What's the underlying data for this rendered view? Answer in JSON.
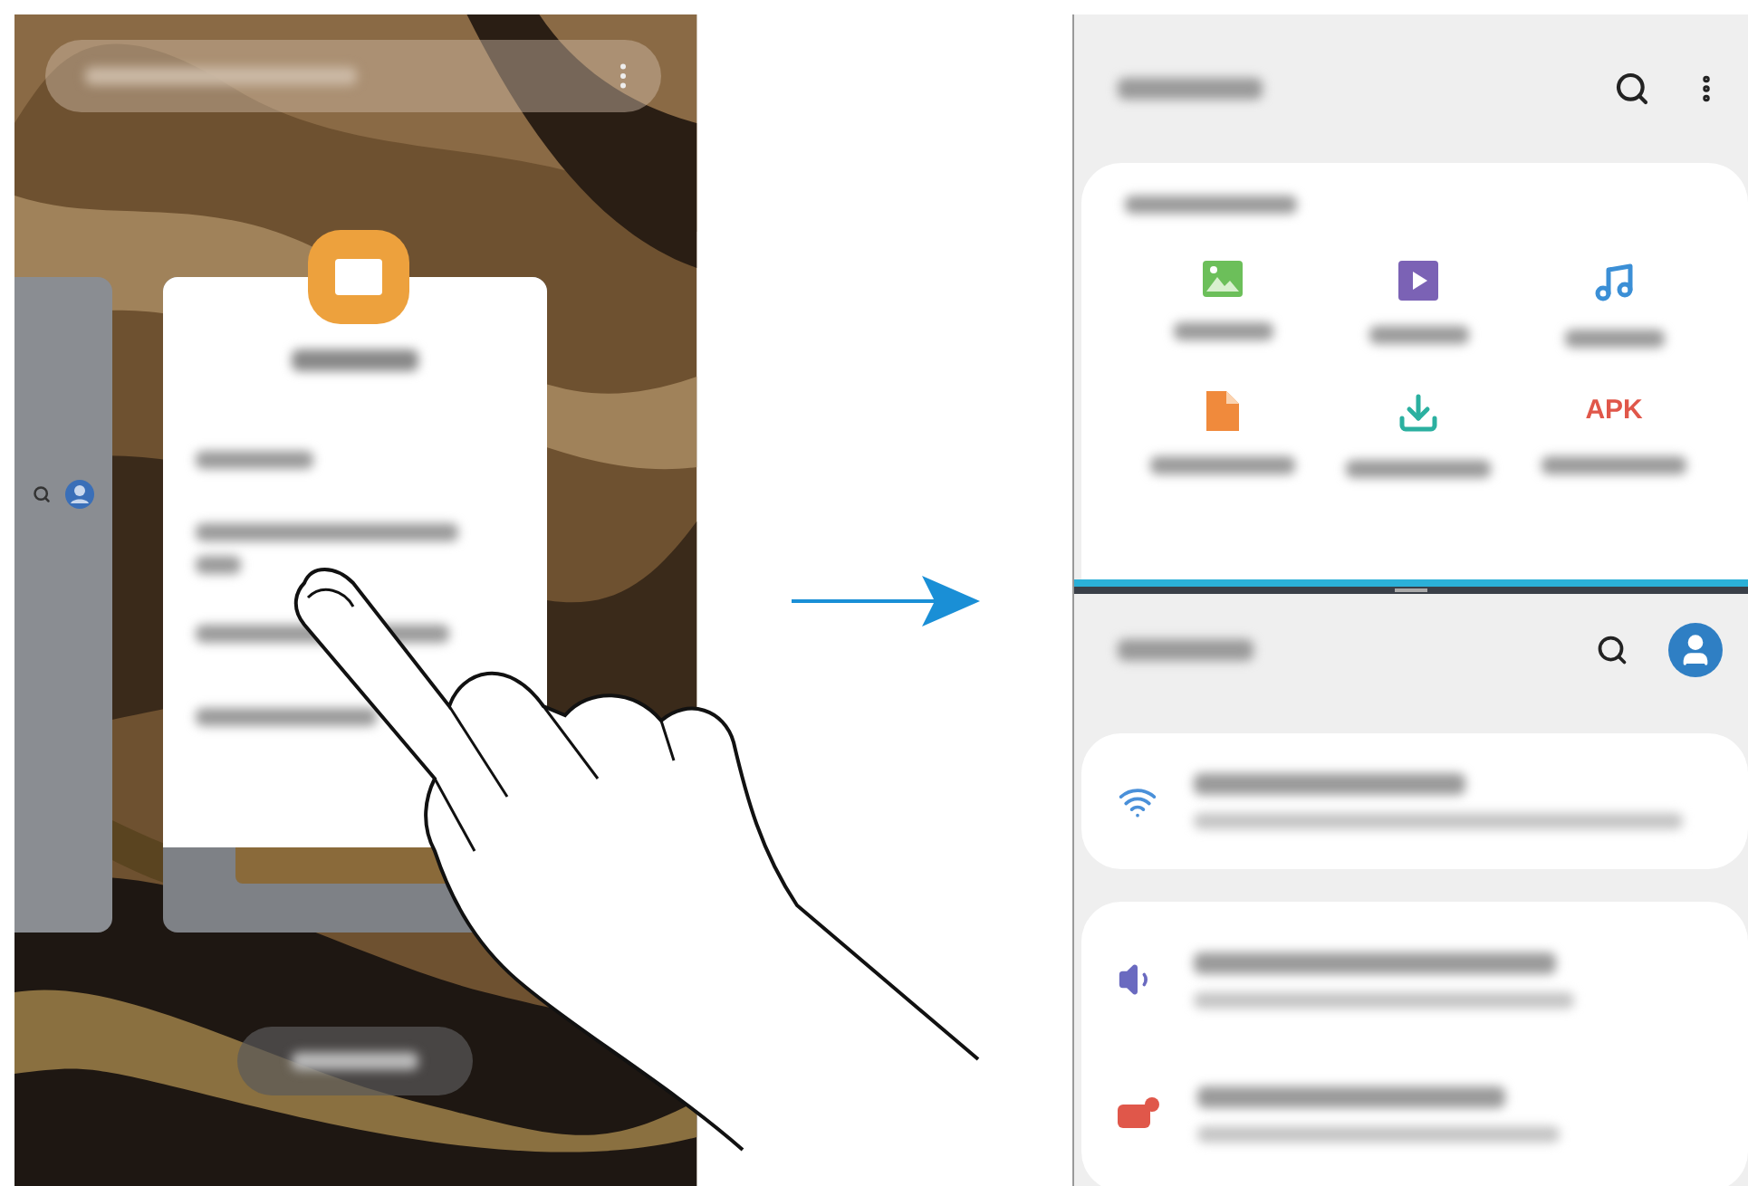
{
  "my_files": {
    "categories": [
      {
        "kind": "images",
        "color": "#6cbf5a"
      },
      {
        "kind": "videos",
        "color": "#7b62b5"
      },
      {
        "kind": "audio",
        "color": "#3b8fd6"
      },
      {
        "kind": "documents",
        "color": "#f08a3c"
      },
      {
        "kind": "downloads",
        "color": "#2bb0a0"
      },
      {
        "kind": "apk",
        "color": "#e0574a",
        "label": "APK"
      }
    ]
  },
  "settings": {
    "items": [
      {
        "kind": "wifi",
        "color": "#4a90d9"
      },
      {
        "kind": "sound",
        "color": "#6a6ac0"
      },
      {
        "kind": "notifications",
        "color": "#e0574a"
      }
    ]
  }
}
